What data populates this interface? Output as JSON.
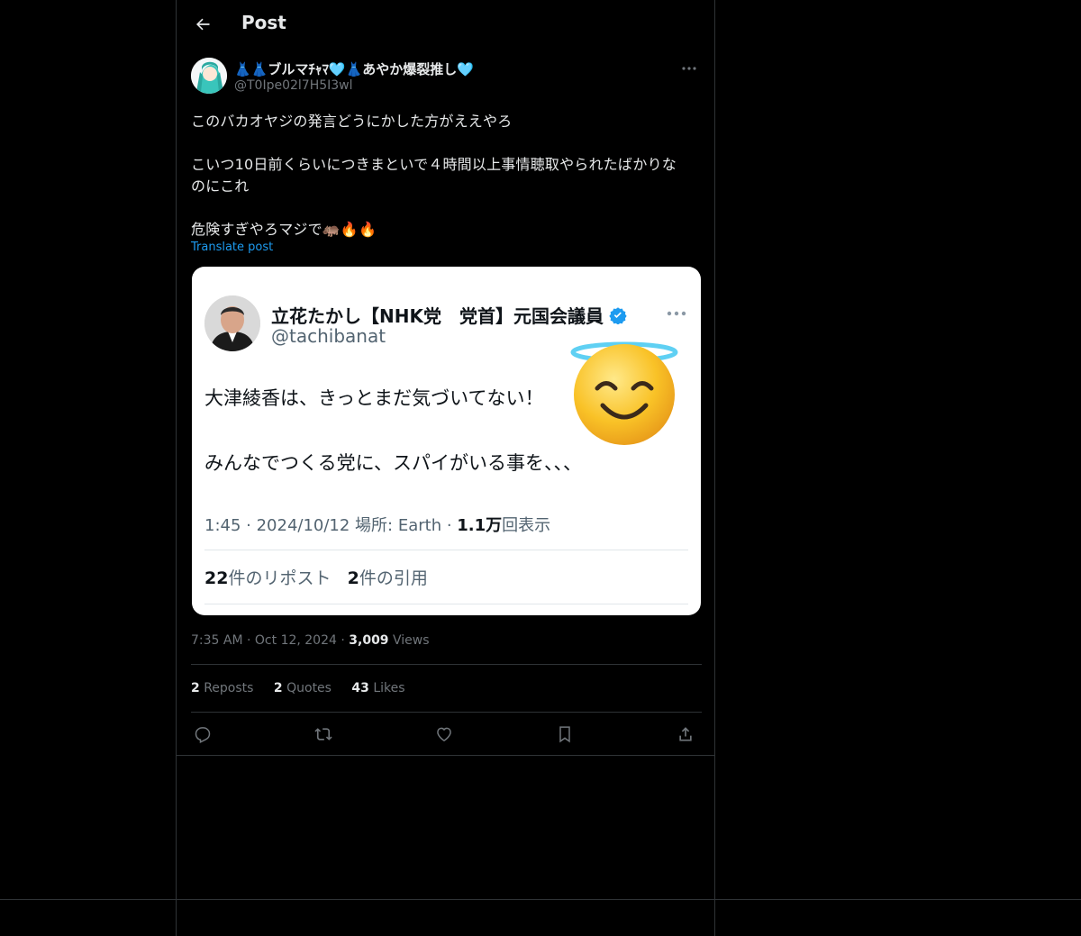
{
  "header": {
    "title": "Post"
  },
  "post": {
    "author": {
      "display_name": "👗👗ブルマﾁｬﾏ🩵👗あやか爆裂推し🩵",
      "handle": "@T0Ipe02l7H5I3wl"
    },
    "text_lines": [
      "このバカオヤジの発言どうにかした方がええやろ",
      "こいつ10日前くらいにつきまといで４時間以上事情聴取やられたばかりな",
      "のにこれ",
      "危険すぎやろマジで🦛🔥🔥"
    ],
    "translate_label": "Translate post",
    "embedded": {
      "name": "立花たかし【NHK党　党首】元国会議員",
      "handle": "@tachibanat",
      "line1": "大津綾香は、きっとまだ気づいてない！",
      "line2": "みんなでつくる党に、スパイがいる事を、、、",
      "meta_prefix": "1:45 · 2024/10/12 場所: Earth · ",
      "meta_views": "1.1万",
      "meta_suffix": "回表示",
      "reposts_count": "22",
      "reposts_label": "件のリポスト",
      "quotes_count": "2",
      "quotes_label": "件の引用"
    },
    "time": "7:35 AM",
    "date": "Oct 12, 2024",
    "views_count": "3,009",
    "views_label": "Views",
    "reposts_count": "2",
    "reposts_label": "Reposts",
    "quotes_count": "2",
    "quotes_label": "Quotes",
    "likes_count": "43",
    "likes_label": "Likes"
  },
  "colors": {
    "background": "#000000",
    "text": "#e7e9ea",
    "muted": "#71767b",
    "accent": "#1d9bf0",
    "border": "#2f3336"
  },
  "icons": [
    "back-arrow-icon",
    "more-icon",
    "verified-badge-icon",
    "reply-icon",
    "repost-icon",
    "like-icon",
    "bookmark-icon",
    "share-icon"
  ]
}
